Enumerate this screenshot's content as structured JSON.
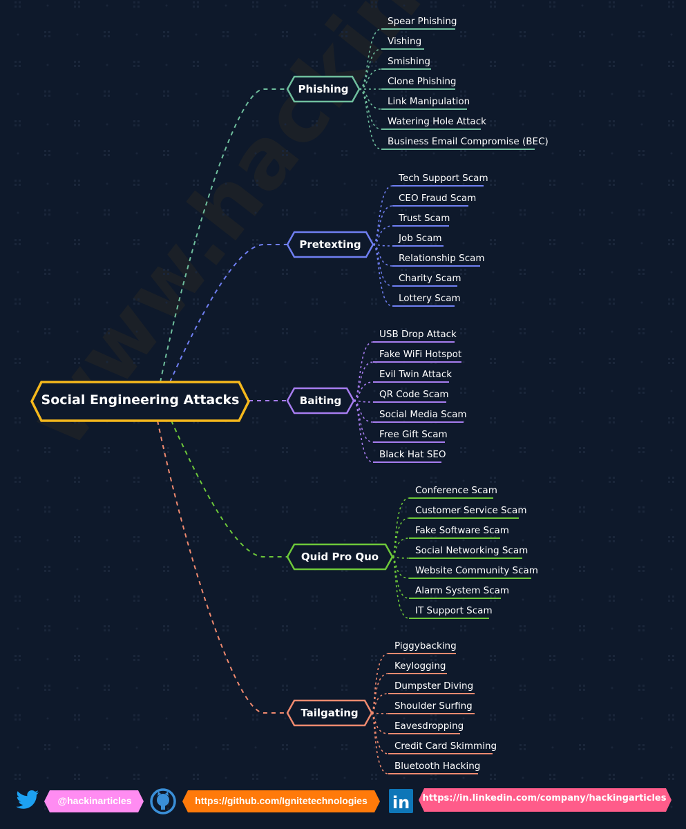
{
  "root": {
    "label": "Social Engineering Attacks",
    "color": "#f5b81c"
  },
  "watermark": "www.hackingarticles.in",
  "branches": [
    {
      "label": "Phishing",
      "color": "#6fbf9e",
      "items": [
        "Spear Phishing",
        "Vishing",
        "Smishing",
        "Clone Phishing",
        "Link Manipulation",
        "Watering Hole Attack",
        "Business Email Compromise (BEC)"
      ]
    },
    {
      "label": "Pretexting",
      "color": "#6f7ff2",
      "items": [
        "Tech Support Scam",
        "CEO Fraud Scam",
        "Trust Scam",
        "Job Scam",
        "Relationship Scam",
        "Charity Scam",
        "Lottery Scam"
      ]
    },
    {
      "label": "Baiting",
      "color": "#a77df0",
      "items": [
        "USB Drop Attack",
        "Fake WiFi Hotspot",
        "Evil Twin Attack",
        "QR Code Scam",
        "Social Media Scam",
        "Free Gift Scam",
        "Black Hat SEO"
      ]
    },
    {
      "label": "Quid Pro Quo",
      "color": "#6dc83a",
      "items": [
        "Conference Scam",
        "Customer Service Scam",
        "Fake Software Scam",
        "Social Networking Scam",
        "Website Community Scam",
        "Alarm System Scam",
        "IT Support Scam"
      ]
    },
    {
      "label": "Tailgating",
      "color": "#f08a6f",
      "items": [
        "Piggybacking",
        "Keylogging",
        "Dumpster Diving",
        "Shoulder Surfing",
        "Eavesdropping",
        "Credit Card Skimming",
        "Bluetooth Hacking"
      ]
    }
  ],
  "footer": {
    "twitter": {
      "icon": "twitter-bird-icon",
      "label": "@hackinarticles",
      "color": "#ff8cf2",
      "icon_color": "#1da1f2"
    },
    "github": {
      "icon": "github-octocat-icon",
      "label": "https://github.com/Ignitetechnologies",
      "color": "#ff7a0a",
      "icon_color": "#3a8fd8"
    },
    "linkedin": {
      "icon": "linkedin-icon",
      "label": "https://in.linkedin.com/company/hackingarticles",
      "color": "#ff5c8a",
      "icon_color": "#0e76b8"
    }
  }
}
